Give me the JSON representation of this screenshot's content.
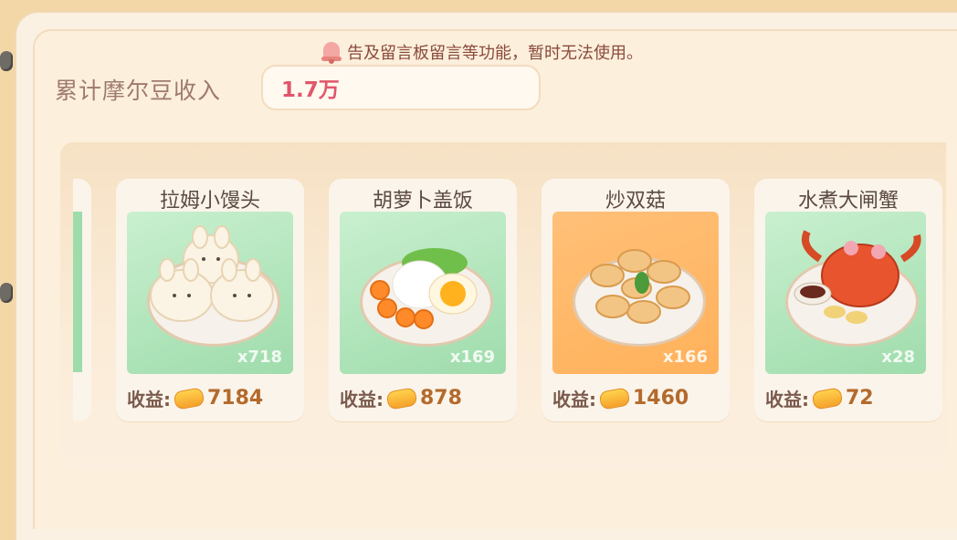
{
  "notice": "告及留言板留言等功能，暂时无法使用。",
  "earnings": {
    "label": "累计摩尔豆收入",
    "value": "1.7万"
  },
  "dishes": [
    {
      "name": "拉姆小馒头",
      "qty": "x718",
      "profit_label": "收益:",
      "profit": "7184",
      "bg": "green"
    },
    {
      "name": "胡萝卜盖饭",
      "qty": "x169",
      "profit_label": "收益:",
      "profit": "878",
      "bg": "green"
    },
    {
      "name": "炒双菇",
      "qty": "x166",
      "profit_label": "收益:",
      "profit": "1460",
      "bg": "orange"
    },
    {
      "name": "水煮大闸蟹",
      "qty": "x28",
      "profit_label": "收益:",
      "profit": "72",
      "bg": "green"
    }
  ],
  "icons": {
    "notice": "bell-icon",
    "currency": "mole-bean-icon"
  },
  "colors": {
    "earnings_value": "#e0566b",
    "card_bg": "#fbf4ea"
  }
}
